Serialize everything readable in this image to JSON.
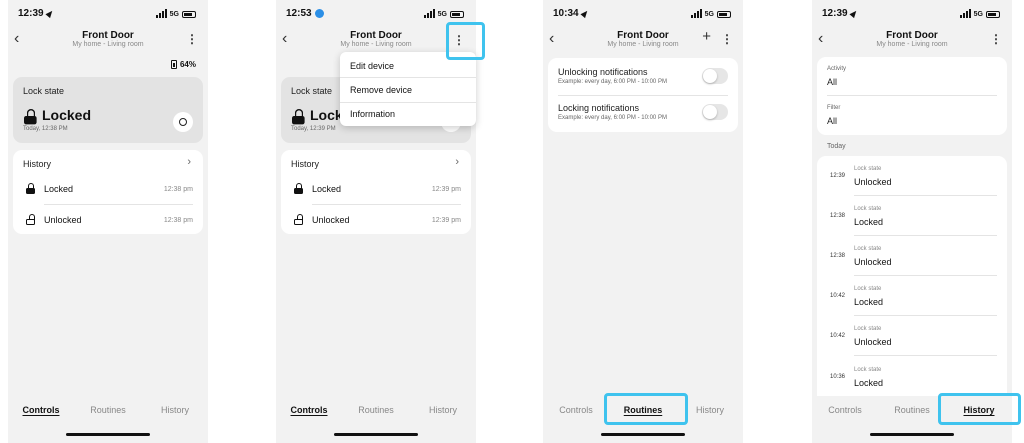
{
  "common": {
    "title": "Front Door",
    "subtitle": "My home - Living room",
    "network": "5G",
    "tabs": [
      "Controls",
      "Routines",
      "History"
    ],
    "accent_color": "#3fc3ee"
  },
  "screen1": {
    "time": "12:39",
    "battery_level": "64%",
    "lock_state_label": "Lock state",
    "lock_state_value": "Locked",
    "lock_state_time": "Today, 12:38 PM",
    "history_label": "History",
    "history_items": [
      {
        "label": "Locked",
        "time": "12:38 pm"
      },
      {
        "label": "Unlocked",
        "time": "12:38 pm"
      }
    ]
  },
  "screen2": {
    "time": "12:53",
    "lock_state_label": "Lock state",
    "lock_state_value": "Locked",
    "lock_state_time": "Today, 12:39 PM",
    "menu_items": [
      "Edit device",
      "Remove device",
      "Information"
    ],
    "history_label": "History",
    "history_items": [
      {
        "label": "Locked",
        "time": "12:39 pm"
      },
      {
        "label": "Unlocked",
        "time": "12:39 pm"
      }
    ]
  },
  "screen3": {
    "time": "10:34",
    "notifications": [
      {
        "label": "Unlocking notifications",
        "desc": "Example: every day, 6:00 PM - 10:00 PM"
      },
      {
        "label": "Locking notifications",
        "desc": "Example: every day, 6:00 PM - 10:00 PM"
      }
    ]
  },
  "screen4": {
    "time": "12:39",
    "activity_label": "Activity",
    "activity_value": "All",
    "filter_label": "Filter",
    "filter_value": "All",
    "section_label": "Today",
    "entries": [
      {
        "time": "12:39",
        "caption": "Lock state",
        "value": "Unlocked"
      },
      {
        "time": "12:38",
        "caption": "Lock state",
        "value": "Locked"
      },
      {
        "time": "12:38",
        "caption": "Lock state",
        "value": "Unlocked"
      },
      {
        "time": "10:42",
        "caption": "Lock state",
        "value": "Locked"
      },
      {
        "time": "10:42",
        "caption": "Lock state",
        "value": "Unlocked"
      },
      {
        "time": "10:36",
        "caption": "Lock state",
        "value": "Locked"
      }
    ]
  }
}
